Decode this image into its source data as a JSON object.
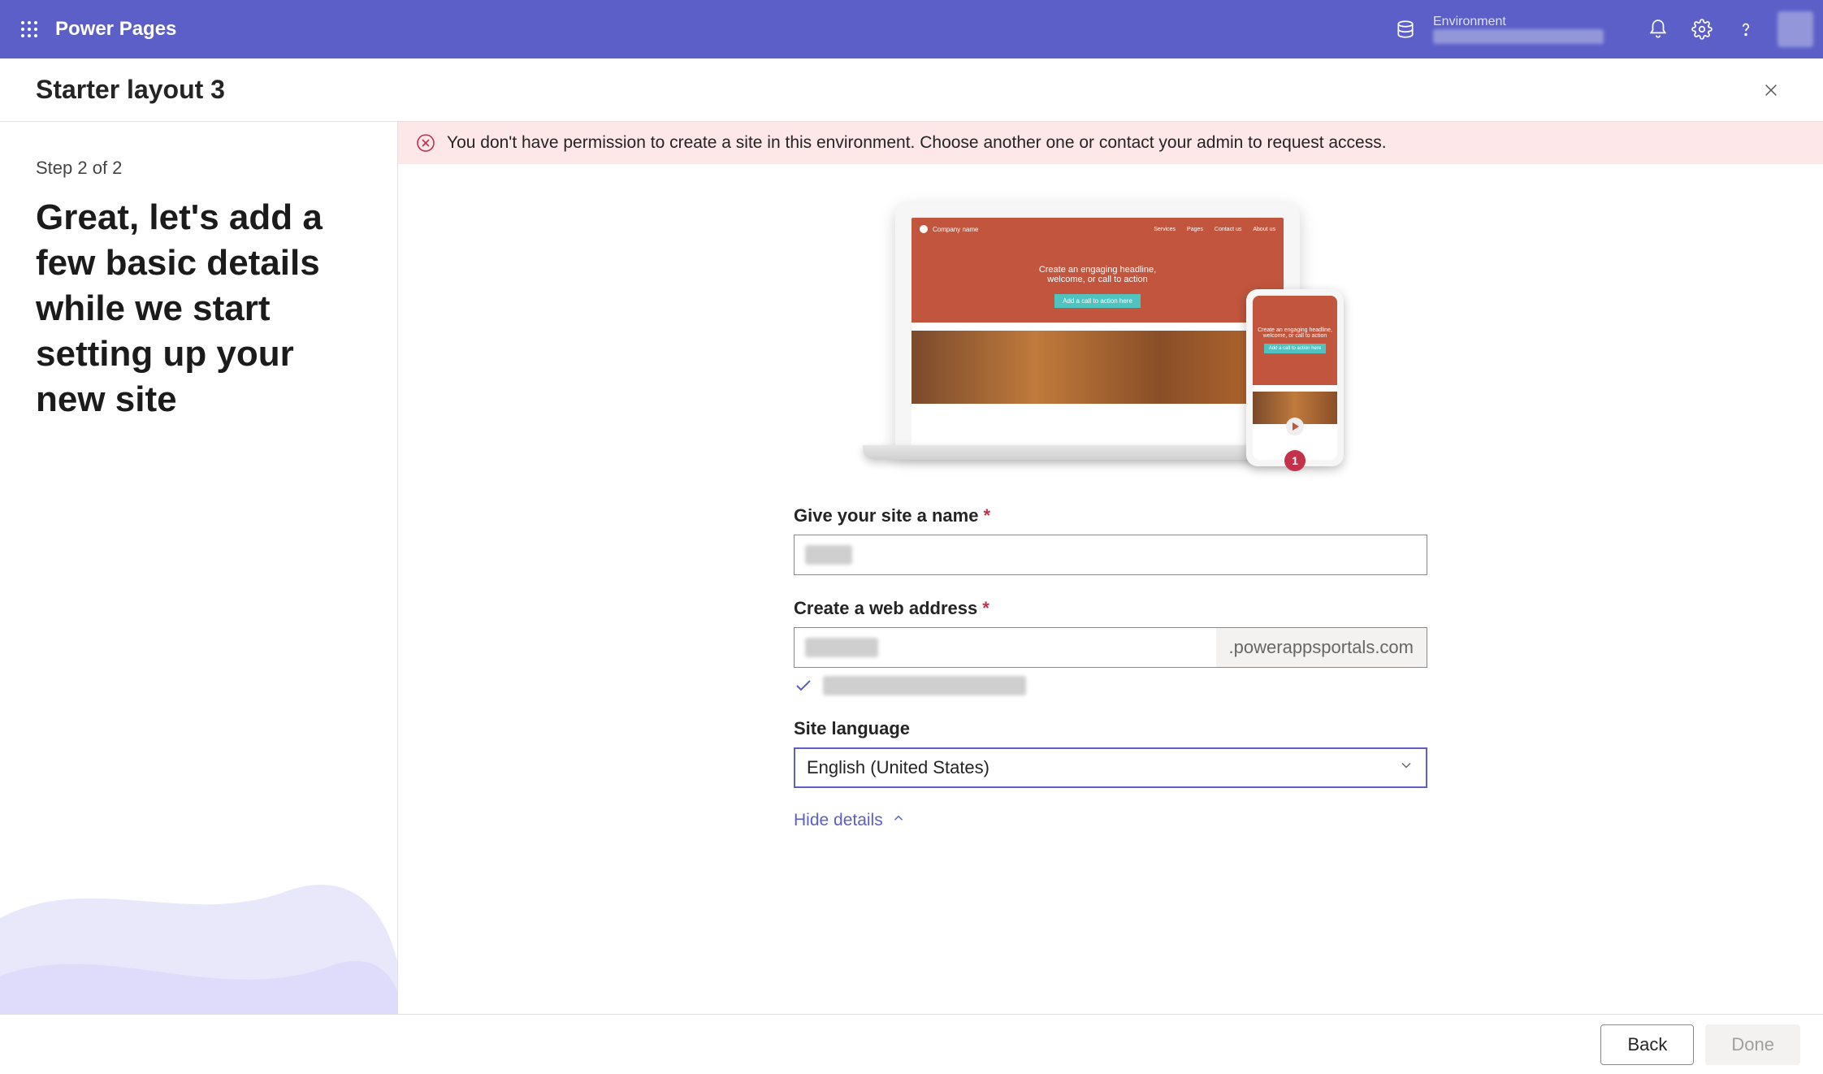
{
  "topbar": {
    "app_title": "Power Pages",
    "env_label": "Environment"
  },
  "subheader": {
    "title": "Starter layout 3"
  },
  "sidebar": {
    "step": "Step 2 of 2",
    "headline": "Great, let's add a few basic details while we start setting up your new site"
  },
  "error": {
    "message": "You don't have permission to create a site in this environment. Choose another one or contact your admin to request access."
  },
  "preview": {
    "company": "Company name",
    "nav": [
      "Services",
      "Pages",
      "Contact us",
      "About us"
    ],
    "hero_line1": "Create an engaging headline,",
    "hero_line2": "welcome, or call to action",
    "cta": "Add a call to action here",
    "badge": "1"
  },
  "form": {
    "name_label": "Give your site a name",
    "address_label": "Create a web address",
    "address_suffix": ".powerappsportals.com",
    "language_label": "Site language",
    "language_value": "English (United States)",
    "hide_details": "Hide details"
  },
  "footer": {
    "back": "Back",
    "done": "Done"
  }
}
